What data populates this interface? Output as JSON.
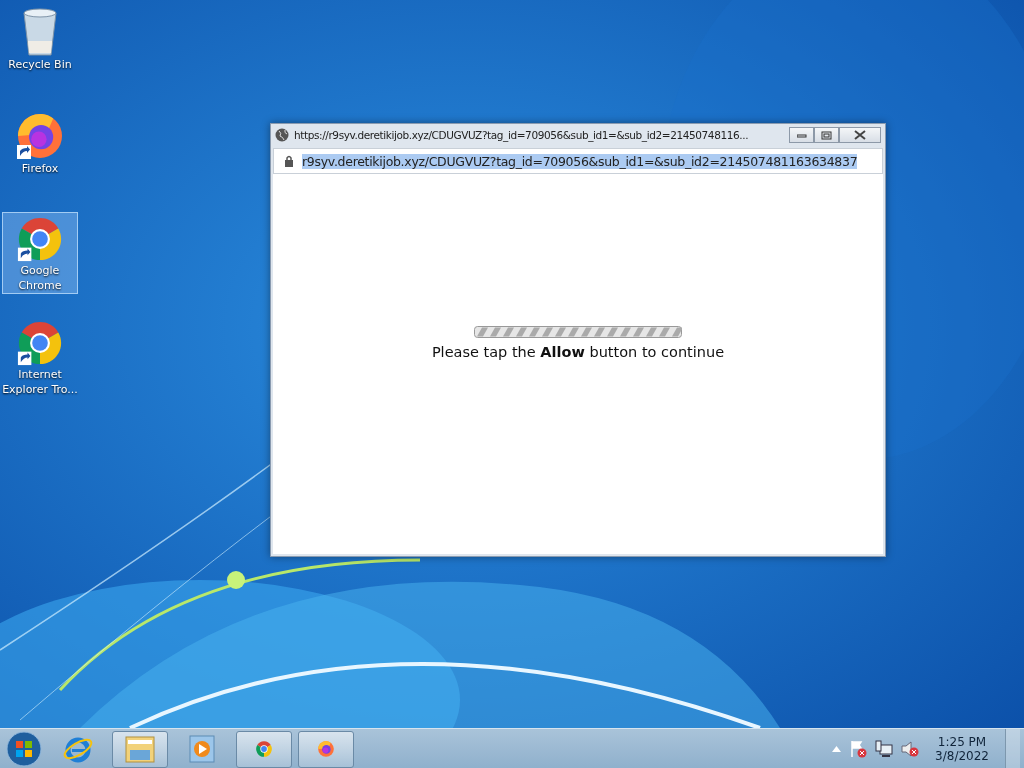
{
  "desktop": {
    "icons": [
      {
        "label": "Recycle Bin",
        "kind": "recycle",
        "selected": false
      },
      {
        "label": "Firefox",
        "kind": "firefox",
        "selected": false
      },
      {
        "label": "Google Chrome",
        "kind": "chrome",
        "selected": true
      },
      {
        "label": "Internet Explorer Tro...",
        "kind": "chrome",
        "selected": false
      }
    ]
  },
  "popup": {
    "title": "https://r9syv.deretikijob.xyz/CDUGVUZ?tag_id=709056&sub_id1=&sub_id2=21450748116...",
    "address": "r9syv.deretikijob.xyz/CDUGVUZ?tag_id=709056&sub_id1=&sub_id2=214507481163634837",
    "address_selected": true,
    "message": "Please tap the **Allow** button to continue"
  },
  "taskbar": {
    "items": [
      {
        "kind": "ie",
        "running": false
      },
      {
        "kind": "explorer",
        "running": true
      },
      {
        "kind": "media",
        "running": false
      },
      {
        "kind": "chrome",
        "running": true
      },
      {
        "kind": "firefox",
        "running": true
      }
    ],
    "clock": {
      "time": "1:25 PM",
      "date": "3/8/2022"
    }
  }
}
